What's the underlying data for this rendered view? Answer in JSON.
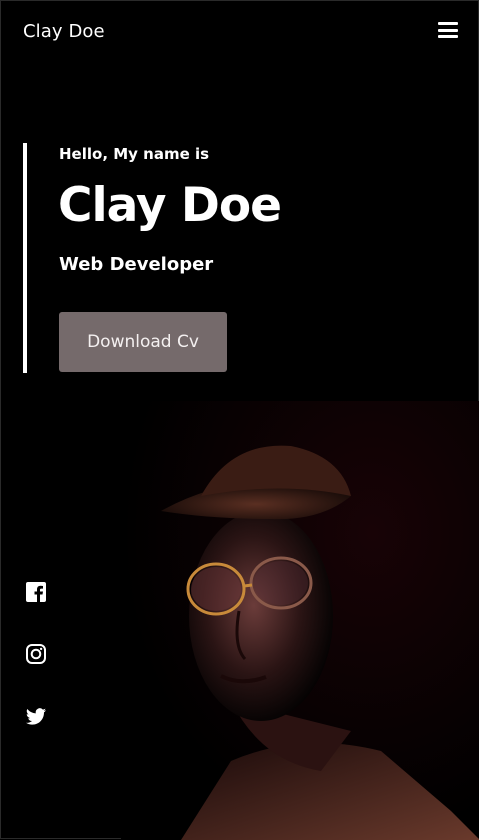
{
  "header": {
    "brand": "Clay Doe",
    "menu_icon": "hamburger-menu-icon"
  },
  "hero": {
    "greeting": "Hello, My name is",
    "name": "Clay Doe",
    "role": "Web Developer",
    "download_label": "Download Cv"
  },
  "social": [
    {
      "icon": "facebook-icon"
    },
    {
      "icon": "instagram-icon"
    },
    {
      "icon": "twitter-icon"
    }
  ],
  "colors": {
    "background": "#000000",
    "text": "#ffffff",
    "button": "#756a6b"
  }
}
